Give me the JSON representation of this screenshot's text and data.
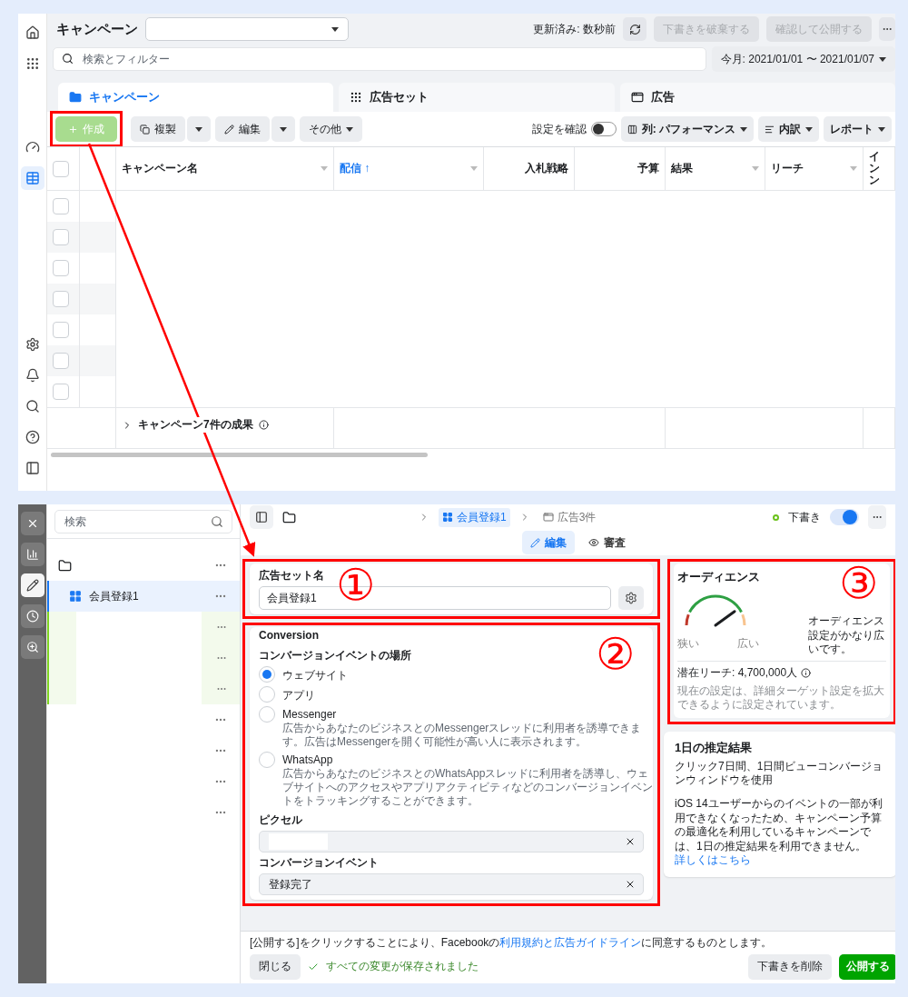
{
  "campaign_manager": {
    "rail": [
      {
        "kind": "home",
        "selected": false
      },
      {
        "kind": "apps",
        "selected": false
      },
      {
        "kind": "gauge",
        "selected": false
      },
      {
        "kind": "table",
        "selected": true
      },
      {
        "kind": "settings",
        "selected": false
      },
      {
        "kind": "bell",
        "selected": false
      },
      {
        "kind": "search",
        "selected": false
      },
      {
        "kind": "help",
        "selected": false
      },
      {
        "kind": "panel",
        "selected": false
      }
    ],
    "title": "キャンペーン",
    "updated": "更新済み: 数秒前",
    "buttons": [
      {
        "label": "下書きを破棄する",
        "disabled": true
      },
      {
        "label": "確認して公開する",
        "disabled": true
      }
    ],
    "search": {
      "placeholder": "検索とフィルター"
    },
    "date_range": "今月: 2021/01/01 〜 2021/01/07",
    "tabs": [
      {
        "kind": "campaign",
        "label": "キャンペーン",
        "selected": true
      },
      {
        "kind": "adset",
        "label": "広告セット",
        "selected": false
      },
      {
        "kind": "ad",
        "label": "広告",
        "selected": false
      }
    ],
    "toolbar": {
      "create": {
        "label": "作成",
        "disabled": true
      },
      "duplicate": "複製",
      "edit": "編集",
      "more": "その他",
      "review": {
        "label": "設定を確認",
        "on": false
      },
      "columns": "列: パフォーマンス",
      "breakdown": "内訳",
      "reports": "レポート"
    },
    "table": {
      "columns": [
        {
          "kind": "text",
          "label": "キャンペーン名",
          "sorted": false
        },
        {
          "kind": "text",
          "label": "配信 ↑",
          "sorted": true
        },
        {
          "kind": "number",
          "label": "入札戦略",
          "sorted": false
        },
        {
          "kind": "number",
          "label": "予算",
          "sorted": false
        },
        {
          "kind": "text",
          "label": "結果",
          "sorted": false
        },
        {
          "kind": "text",
          "label": "リーチ",
          "sorted": false
        },
        {
          "kind": "narrow",
          "label": "インン",
          "sorted": false
        }
      ],
      "select_all": {
        "checked": false
      },
      "rows": [
        {
          "checked": false
        },
        {
          "checked": false
        },
        {
          "checked": false
        },
        {
          "checked": false
        },
        {
          "checked": false
        },
        {
          "checked": false
        },
        {
          "checked": false
        }
      ],
      "summary": "キャンペーン7件の成果"
    }
  },
  "editor": {
    "rail": [
      {
        "kind": "close",
        "selected": false
      },
      {
        "kind": "chart",
        "selected": false
      },
      {
        "kind": "edit",
        "selected": true
      },
      {
        "kind": "clock",
        "selected": false
      },
      {
        "kind": "inspect",
        "selected": false
      }
    ],
    "search": {
      "placeholder": "検索"
    },
    "tree": [
      {
        "kind": "campaign",
        "selected": false,
        "children": [
          {
            "kind": "adset",
            "label": "会員登録1",
            "selected": true,
            "children": [
              {
                "kind": "ad",
                "selected": false
              },
              {
                "kind": "ad",
                "selected": false
              },
              {
                "kind": "ad",
                "selected": false
              }
            ]
          }
        ]
      },
      {
        "kind": "blank",
        "selected": false
      },
      {
        "kind": "blank",
        "selected": false
      },
      {
        "kind": "blank",
        "selected": false
      },
      {
        "kind": "blank",
        "selected": false
      }
    ],
    "breadcrumb": [
      {
        "kind": "adset",
        "label": "会員登録1",
        "selected": true
      },
      {
        "kind": "ad",
        "label": "広告3件",
        "selected": false
      }
    ],
    "status": {
      "label": "下書き",
      "color": "#6bc21b",
      "on": true
    },
    "view_tabs": [
      {
        "kind": "edit",
        "label": "編集",
        "selected": true
      },
      {
        "kind": "review",
        "label": "審査",
        "selected": false
      }
    ],
    "adset_name": {
      "label": "広告セット名",
      "value": "会員登録1"
    },
    "conversion": {
      "title": "Conversion",
      "location_label": "コンバージョンイベントの場所",
      "options": [
        {
          "label": "ウェブサイト",
          "selected": true
        },
        {
          "label": "アプリ",
          "selected": false
        },
        {
          "label": "Messenger",
          "description": "広告からあなたのビジネスとのMessengerスレッドに利用者を誘導できます。広告はMessengerを開く可能性が高い人に表示されます。",
          "selected": false
        },
        {
          "label": "WhatsApp",
          "description": "広告からあなたのビジネスとのWhatsAppスレッドに利用者を誘導し、ウェブサイトへのアクセスやアプリアクティビティなどのコンバージョンイベントをトラッキングすることができます。",
          "selected": false
        }
      ],
      "pixel_label": "ピクセル",
      "event_label": "コンバージョンイベント",
      "event_value": "登録完了"
    },
    "audience": {
      "title": "オーディエンス",
      "level": 0.8,
      "low": "狭い",
      "high": "広い",
      "summary": "オーディエンス設定がかなり広いです。",
      "reach": "潜在リーチ: 4,700,000人",
      "note": "現在の設定は、詳細ターゲット設定を拡大できるように設定されています。"
    },
    "estimate": {
      "title": "1日の推定結果",
      "subtitle": "クリック7日間、1日間ビューコンバージョンウィンドウを使用",
      "body": "iOS 14ユーザーからのイベントの一部が利用できなくなったため、キャンペーン予算の最適化を利用しているキャンペーンでは、1日の推定結果を利用できません。",
      "link": "詳しくはこちら"
    },
    "footer": {
      "terms_before": "[公開する]をクリックすることにより、Facebookの",
      "terms_link": "利用規約と広告ガイドライン",
      "terms_after": "に同意するものとします。",
      "close": "閉じる",
      "saved": "すべての変更が保存されました",
      "delete_draft": "下書きを削除",
      "publish": "公開する"
    }
  },
  "annotations": {
    "numbers": [
      "①",
      "②",
      "③"
    ]
  }
}
